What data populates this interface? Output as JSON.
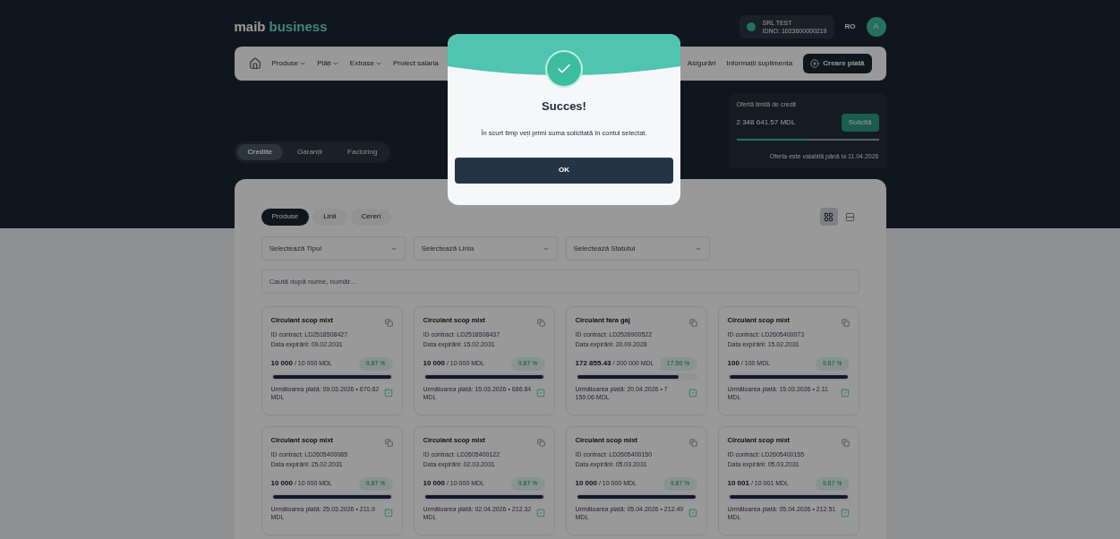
{
  "header": {
    "logo_brand": "maib",
    "logo_product": "business",
    "account": {
      "name": "SRL TEST",
      "idno": "IDNO: 1023600000219"
    },
    "language": "RO",
    "avatar": "A"
  },
  "nav": {
    "items": [
      {
        "label": "Produse",
        "dropdown": true
      },
      {
        "label": "Plăți",
        "dropdown": true
      },
      {
        "label": "Extrase",
        "dropdown": true
      },
      {
        "label": "Proiect salaria",
        "dropdown": false
      }
    ],
    "right_items": [
      {
        "label": "Asigurări"
      },
      {
        "label": "Informații suplimenta"
      }
    ],
    "create_button": "Creare plată"
  },
  "credit_offer": {
    "label": "Ofertă limită de credit",
    "amount": "2 348 641.57 MDL",
    "button": "Solicită",
    "level": 0.5,
    "validity": "Oferta este valabilă până la 11.04.2026"
  },
  "category_tabs": [
    {
      "label": "Credite",
      "selected": true
    },
    {
      "label": "Garanții",
      "selected": false
    },
    {
      "label": "Factoring",
      "selected": false
    }
  ],
  "panel": {
    "view_tabs": [
      {
        "label": "Produse",
        "selected": true
      },
      {
        "label": "Linii",
        "selected": false
      },
      {
        "label": "Cereri",
        "selected": false
      }
    ],
    "view_toggle": [
      {
        "kind": "grid",
        "selected": true
      },
      {
        "kind": "list",
        "selected": false
      }
    ],
    "filters": [
      {
        "placeholder": "Selectează Tipul"
      },
      {
        "placeholder": "Selectează Linia"
      },
      {
        "placeholder": "Selectează Statutul"
      }
    ],
    "search": {
      "placeholder": "Caută după nume, număr..."
    },
    "cards": [
      {
        "title": "Circulant scop mixt",
        "contract": "ID contract: LD2518508427",
        "expiry": "Data expirării: 09.02.2031",
        "used": "10 000",
        "limit": "/ 10 000 MDL",
        "rate": "9.87 %",
        "level": 1,
        "next_payment": "Următoarea plată: 09.03.2026 • 670.62 MDL"
      },
      {
        "title": "Circulant scop mixt",
        "contract": "ID contract: LD2518508437",
        "expiry": "Data expirării: 15.02.2031",
        "used": "10 000",
        "limit": "/ 10 000 MDL",
        "rate": "9.87 %",
        "level": 1,
        "next_payment": "Următoarea plată: 15.03.2026 • 686.84 MDL"
      },
      {
        "title": "Circulant fara gaj",
        "contract": "ID contract: LD2526900522",
        "expiry": "Data expirării: 20.09.2028",
        "used": "172 855.43",
        "limit": "/ 200 000 MDL",
        "rate": "17.50 %",
        "level": 0.86,
        "next_payment": "Următoarea plată: 20.04.2026 • 7 159.06 MDL"
      },
      {
        "title": "Circulant scop mixt",
        "contract": "ID contract: LD2605400073",
        "expiry": "Data expirării: 15.02.2031",
        "used": "100",
        "limit": "/ 100 MDL",
        "rate": "9.87 %",
        "level": 1,
        "next_payment": "Următoarea plată: 15.03.2026 • 2.11 MDL"
      },
      {
        "title": "Circulant scop mixt",
        "contract": "ID contract: LD2605400085",
        "expiry": "Data expirării: 25.02.2031",
        "used": "10 000",
        "limit": "/ 10 000 MDL",
        "rate": "9.87 %",
        "level": 1,
        "next_payment": "Următoarea plată: 25.03.2026 • 211.9 MDL"
      },
      {
        "title": "Circulant scop mixt",
        "contract": "ID contract: LD2605400122",
        "expiry": "Data expirării: 02.03.2031",
        "used": "10 000",
        "limit": "/ 10 000 MDL",
        "rate": "9.87 %",
        "level": 1,
        "next_payment": "Următoarea plată: 02.04.2026 • 212.32 MDL"
      },
      {
        "title": "Circulant scop mixt",
        "contract": "ID contract: LD2605400150",
        "expiry": "Data expirării: 05.03.2031",
        "used": "10 000",
        "limit": "/ 10 000 MDL",
        "rate": "9.87 %",
        "level": 1,
        "next_payment": "Următoarea plată: 05.04.2026 • 212.49 MDL"
      },
      {
        "title": "Circulant scop mixt",
        "contract": "ID contract: LD2605400155",
        "expiry": "Data expirării: 05.03.2031",
        "used": "10 001",
        "limit": "/ 10 001 MDL",
        "rate": "9.87 %",
        "level": 1,
        "next_payment": "Următoarea plată: 05.04.2026 • 212.51 MDL"
      }
    ]
  },
  "modal": {
    "title": "Succes!",
    "message": "În scurt timp veți primi suma solicitată în contul selectat.",
    "button": "OK"
  }
}
